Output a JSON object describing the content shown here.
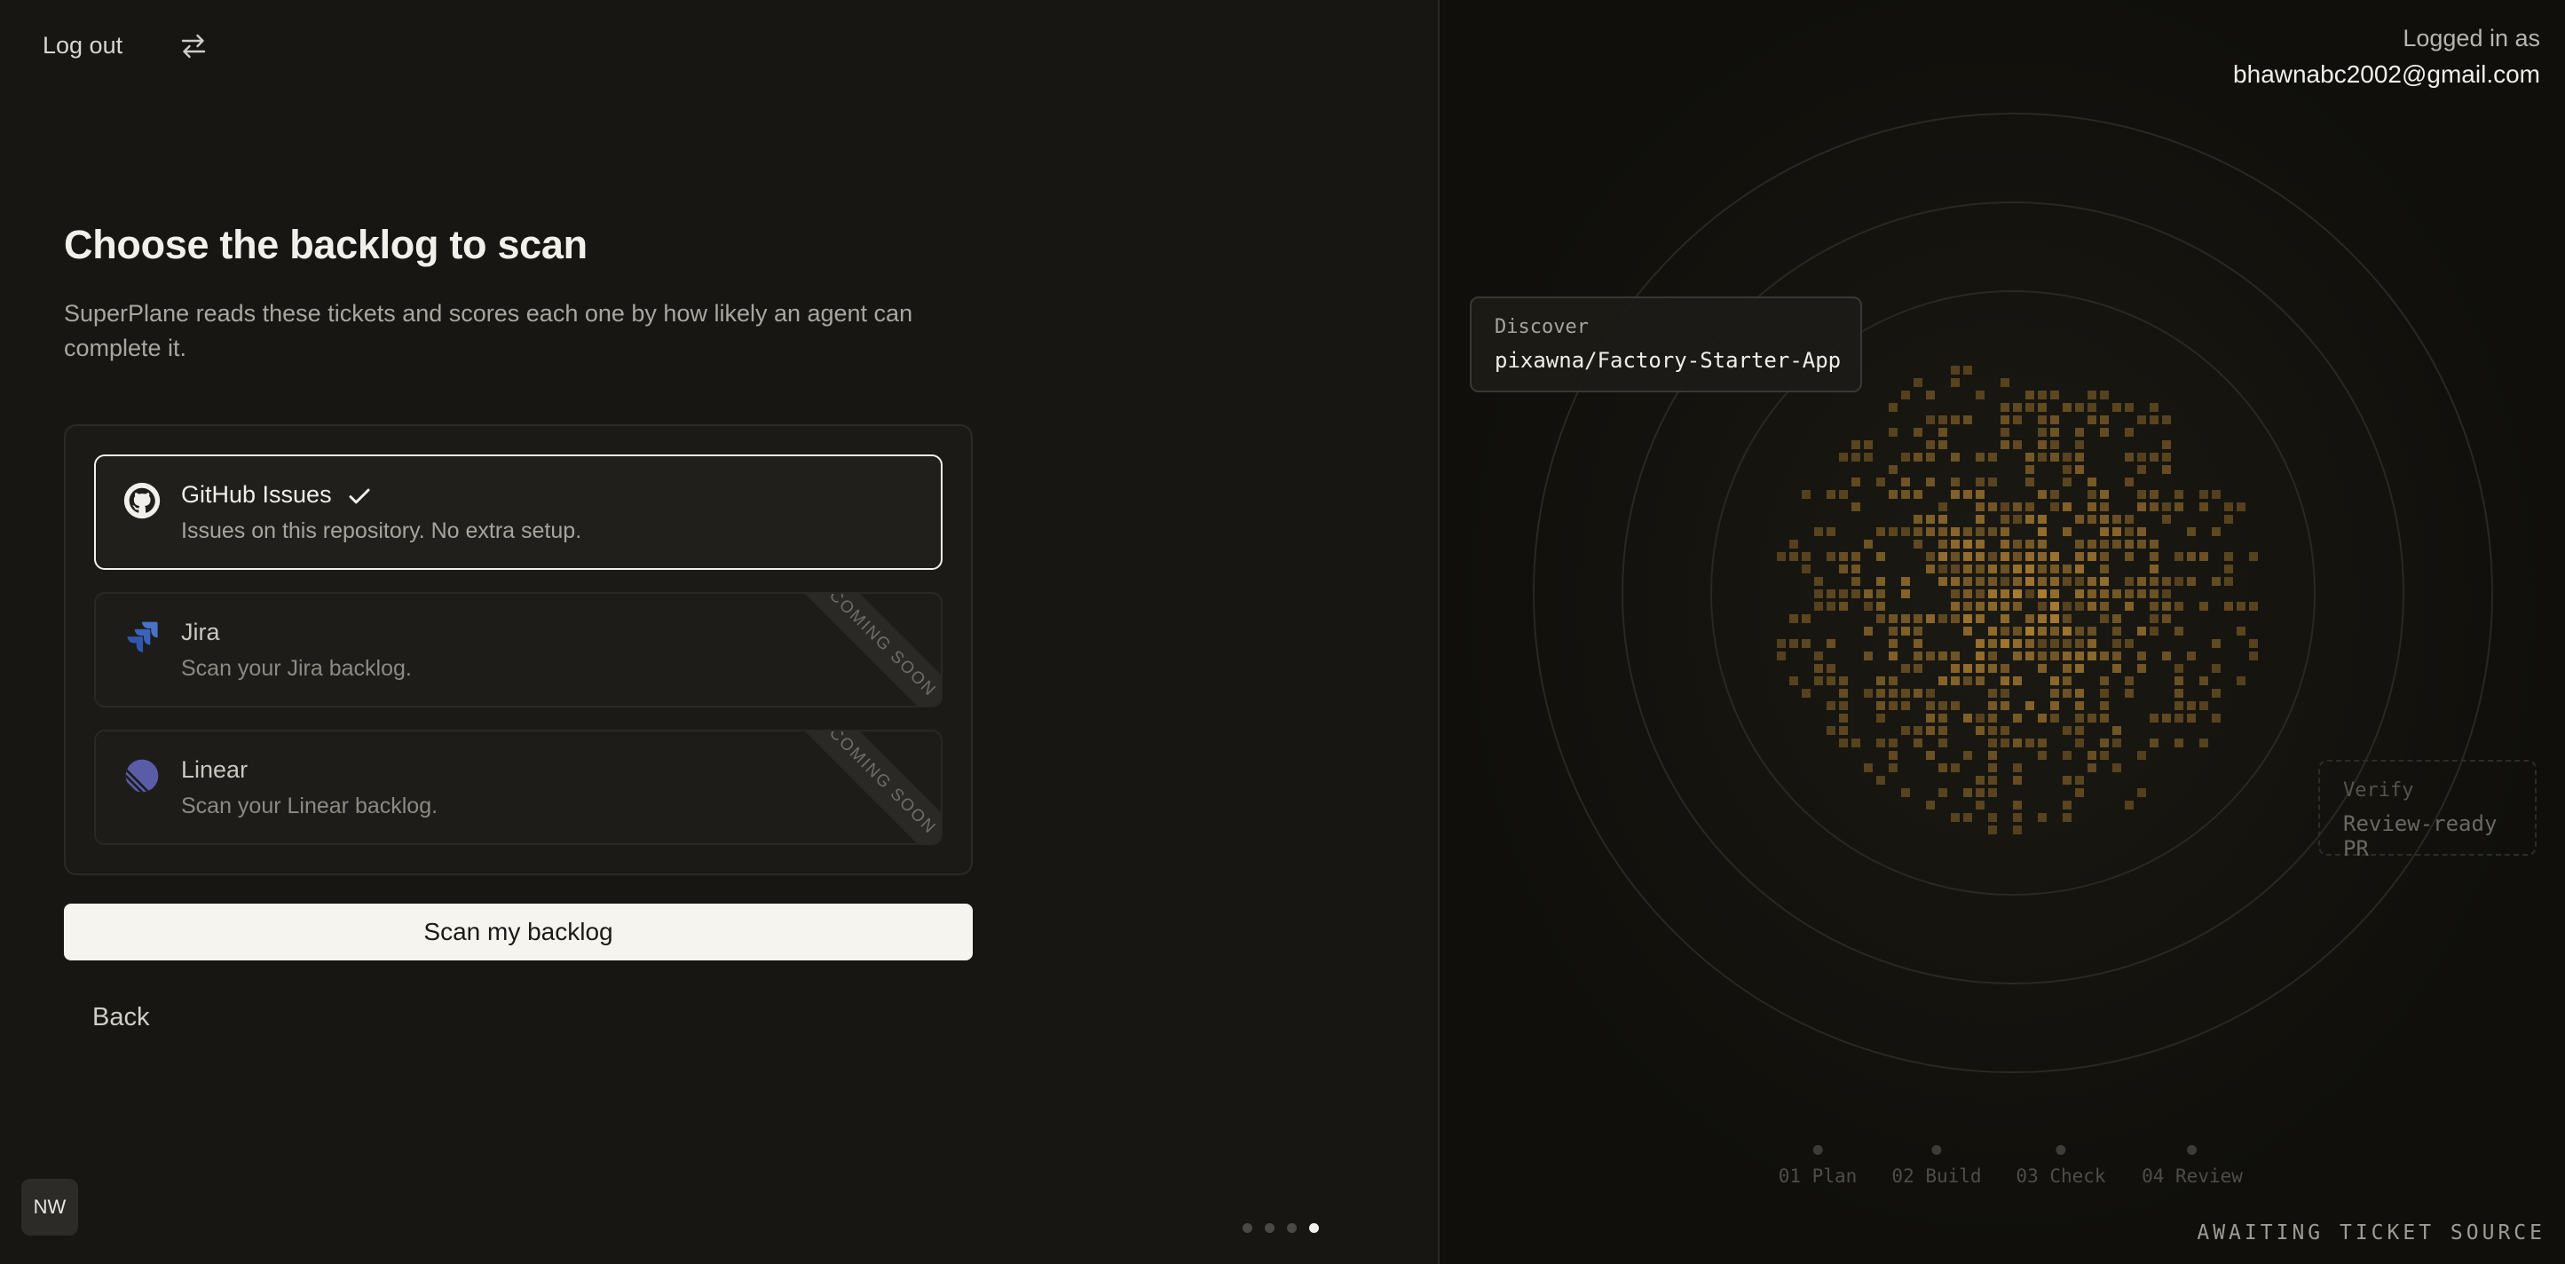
{
  "header": {
    "logout_label": "Log out",
    "switch_icon": "swap-arrows-icon"
  },
  "main": {
    "title": "Choose the backlog to scan",
    "subtitle": "SuperPlane reads these tickets and scores each one by how likely an agent can complete it.",
    "options": [
      {
        "name": "GitHub Issues",
        "description": "Issues on this repository. No extra setup.",
        "icon": "github-icon",
        "selected": true,
        "badge": ""
      },
      {
        "name": "Jira",
        "description": "Scan your Jira backlog.",
        "icon": "jira-icon",
        "selected": false,
        "badge": "COMING SOON"
      },
      {
        "name": "Linear",
        "description": "Scan your Linear backlog.",
        "icon": "linear-icon",
        "selected": false,
        "badge": "COMING SOON"
      }
    ],
    "scan_button": "Scan my backlog",
    "back_label": "Back"
  },
  "avatar": {
    "initials": "NW"
  },
  "pagination": {
    "total": 4,
    "active": 4
  },
  "account": {
    "logged_in_label": "Logged in as",
    "email": "bhawnabc2002@gmail.com"
  },
  "visual": {
    "discover_label": "Discover",
    "discover_value": "pixawna/Factory-Starter-App",
    "verify_label": "Verify",
    "verify_value": "Review-ready PR",
    "steps": [
      "01 Plan",
      "02 Build",
      "03 Check",
      "04 Review"
    ],
    "status": "AWAITING TICKET SOURCE",
    "accent_color": "#c8923a"
  }
}
